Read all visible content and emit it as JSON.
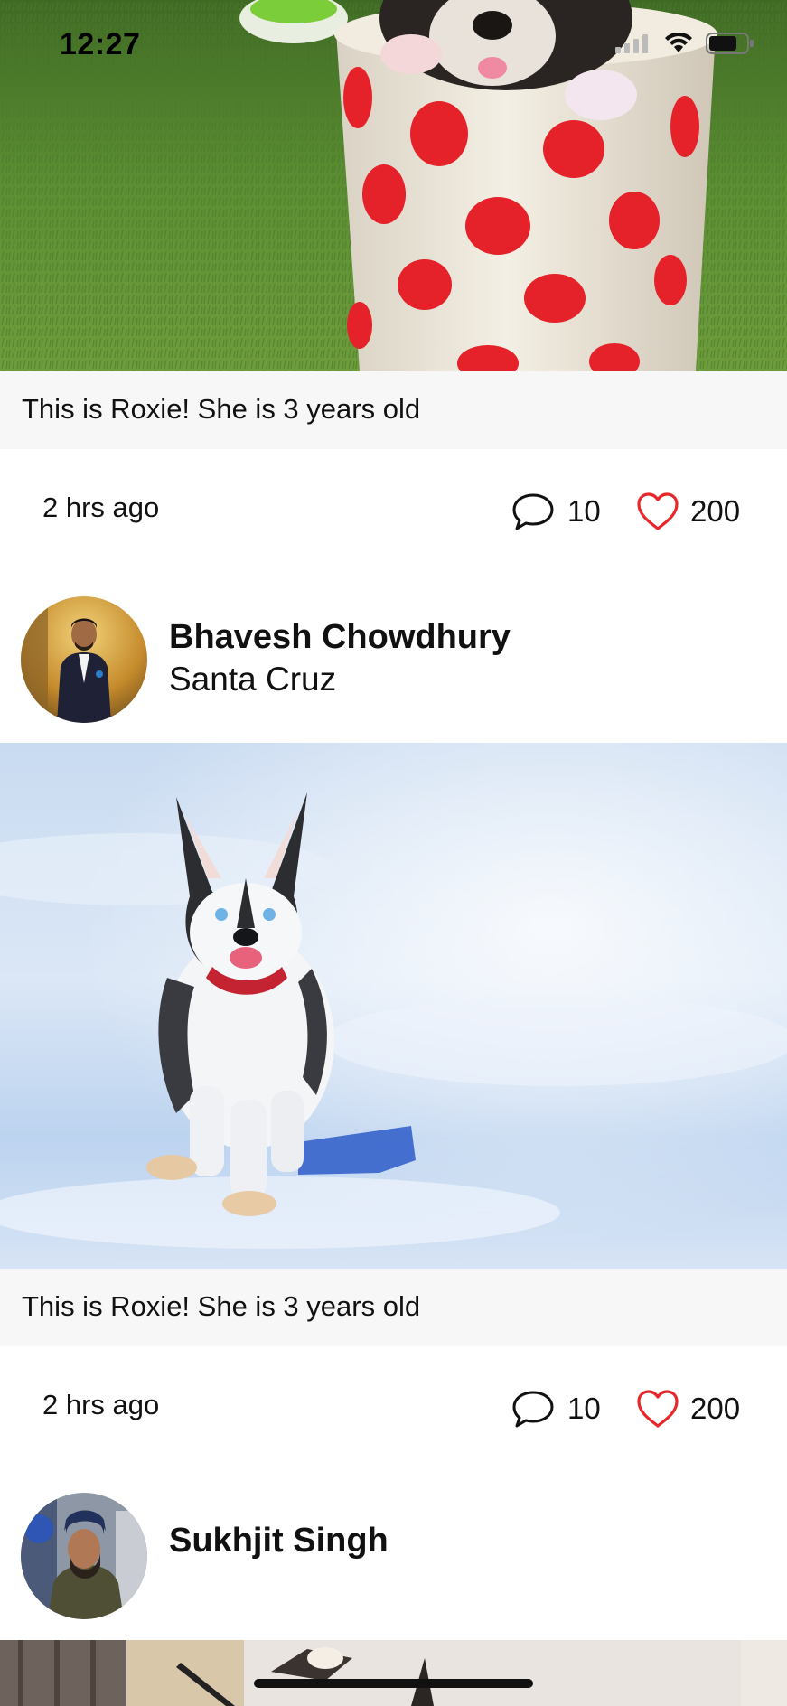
{
  "status_bar": {
    "time": "12:27",
    "icons": [
      "signal-icon",
      "wifi-icon",
      "battery-icon"
    ]
  },
  "posts": [
    {
      "photo_subject": "puppy in polka-dot cup on grass",
      "caption": "This is Roxie! She is 3 years old",
      "time_ago": "2 hrs ago",
      "comments": "10",
      "likes": "200"
    },
    {
      "user_name": "Bhavesh Chowdhury",
      "location": "Santa Cruz",
      "photo_subject": "husky puppy walking on snow",
      "caption": "This is Roxie! She is 3 years old",
      "time_ago": "2 hrs ago",
      "comments": "10",
      "likes": "200"
    },
    {
      "user_name": "Sukhjit Singh",
      "photo_subject": "indoor lamp"
    }
  ],
  "colors": {
    "like_heart": "#e8272b",
    "caption_background": "#f7f7f7",
    "text": "#111111"
  }
}
